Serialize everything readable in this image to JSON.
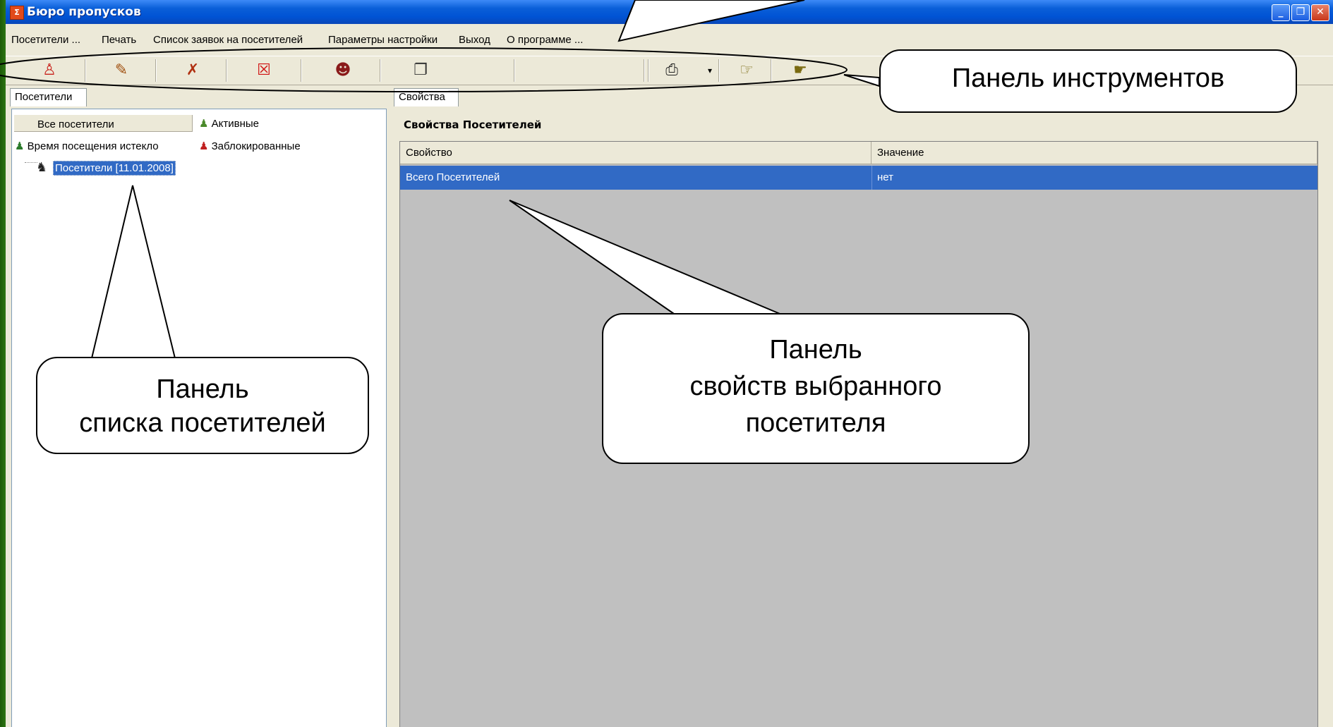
{
  "window": {
    "title": "Бюро пропусков",
    "icon_letter": "Σ",
    "buttons": [
      "minimize-icon",
      "restore-icon",
      "close-icon"
    ]
  },
  "menu": [
    "Посетители ...",
    "Печать",
    "Список заявок на посетителей",
    "Параметры настройки",
    "Выход",
    "О программе ..."
  ],
  "toolbar": {
    "icons": [
      "add-visitor-icon",
      "edit-visitor-icon",
      "block-visitor-icon",
      "delete-visitor-icon",
      "visitor-card-icon",
      "copy-icon",
      "print-icon",
      "dropdown-arrow-icon",
      "pointer-hand-icon",
      "next-hand-icon"
    ]
  },
  "left": {
    "tab": "Посетители",
    "filters": {
      "all": "Все посетители",
      "active": "Активные",
      "expired": "Время посещения истекло",
      "blocked": "Заблокированные"
    },
    "tree_item": "Посетители [11.01.2008]"
  },
  "right": {
    "tab": "Свойства",
    "title": "Свойства Посетителей",
    "columns": [
      "Свойство",
      "Значение"
    ],
    "rows": [
      {
        "property": "Всего Посетителей",
        "value": "нет"
      }
    ]
  },
  "callouts": {
    "toolbar": "Панель инструментов",
    "list": [
      "Панель",
      "списка посетителей"
    ],
    "props": [
      "Панель",
      "свойств выбранного",
      "посетителя"
    ]
  },
  "colors": {
    "titlebar": "#0053d4",
    "selection": "#316ac5",
    "background": "#ece9d8",
    "desktop": "#2f7a12"
  }
}
